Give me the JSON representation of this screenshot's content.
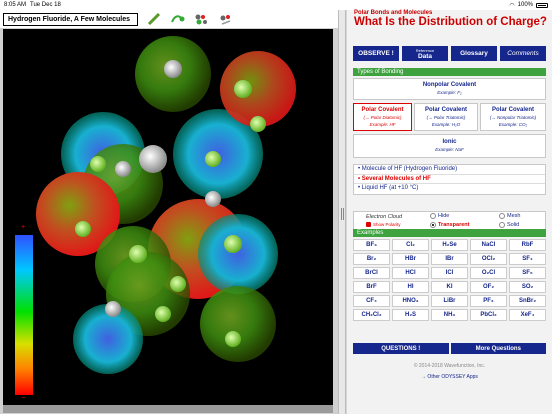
{
  "status": {
    "time": "8:05 AM",
    "date": "Tue Dec 18",
    "battery": "100%"
  },
  "left": {
    "title": "Hydrogen Fluoride, A Few Molecules",
    "tools": [
      "pencil-icon",
      "shake-icon",
      "molecule-split-icon",
      "molecule-rotate-icon"
    ],
    "colorbar": {
      "top_label": "+",
      "bottom_label": "−"
    }
  },
  "right": {
    "subtitle": "Polar Bonds and Molecules",
    "title": "What Is the Distribution of Charge?",
    "tabs": {
      "observe": "OBSERVE !",
      "ref_small": "Reference",
      "data": "Data",
      "glossary": "Glossary",
      "comments": "Comments"
    },
    "bonding_header": "Types of Bonding",
    "nonpolar": {
      "title": "Nonpolar Covalent",
      "example": "Example: F₂"
    },
    "polar": {
      "title": "Polar Covalent",
      "sub": "(→ Polar Diatomic)",
      "example": "Example: HF"
    },
    "polar_tri": {
      "title": "Polar Covalent",
      "sub": "(→ Polar Triatomic)",
      "example": "Example: H₂O"
    },
    "nonpolar_tri": {
      "title": "Polar Covalent",
      "sub": "(→ Nonpolar Triatomic)",
      "example": "Example: CO₂"
    },
    "ionic": {
      "title": "Ionic",
      "example": "Example: NaF"
    },
    "molecule_list": [
      "• Molecule of HF (Hydrogen Fluoride)",
      "• Several Molecules of HF",
      "• Liquid HF (at +10 °C)"
    ],
    "cloud": {
      "label": "Electron Cloud",
      "show_polarity": "Show Polarity",
      "hide": "Hide",
      "transparent": "Transparent",
      "mesh": "Mesh",
      "solid": "Solid"
    },
    "examples_header": "Examples",
    "examples": [
      "BF₃",
      "Cl₂",
      "H₂Se",
      "NaCl",
      "RbF",
      "Br₂",
      "HBr",
      "IBr",
      "OCl₂",
      "SF₄",
      "BrCl",
      "HCl",
      "ICl",
      "O₂Cl",
      "SF₆",
      "BrF",
      "HI",
      "KI",
      "OF₂",
      "SO₂",
      "CF₄",
      "HNO₃",
      "LiBr",
      "PF₃",
      "SnBr₂",
      "CH₂Cl₂",
      "H₂S",
      "NH₃",
      "PbCl₂",
      "XeF₄"
    ],
    "questions": "QUESTIONS !",
    "more_questions": "More Questions",
    "copyright": "© 2014-2018  Wavefunction, Inc.",
    "other_apps": "→ Other ODYSSEY Apps"
  },
  "colors": {
    "accent": "#15268c",
    "red": "#cc0000",
    "green": "#3ea23e"
  }
}
